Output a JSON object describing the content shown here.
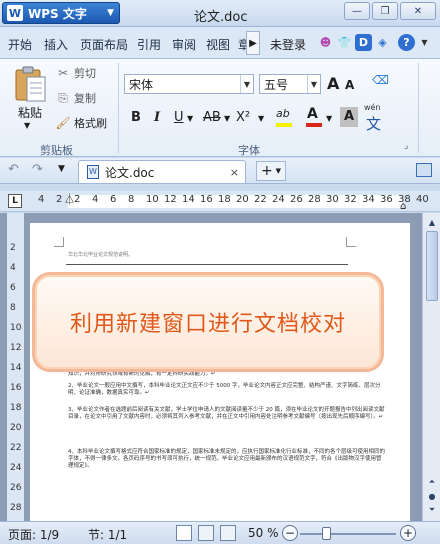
{
  "app": {
    "name": "WPS 文字",
    "logo_letter": "W",
    "dropdown_icon": "triangle-down-icon"
  },
  "window": {
    "title": "论文.doc",
    "buttons": [
      "minimize",
      "restore",
      "close"
    ]
  },
  "menu": {
    "tabs": [
      "开始",
      "插入",
      "页面布局",
      "引用",
      "审阅",
      "视图",
      "章"
    ],
    "login": "未登录"
  },
  "ribbon": {
    "clipboard": {
      "paste_label": "粘贴",
      "cut_label": "剪切",
      "copy_label": "复制",
      "format_painter_label": "格式刷",
      "group_label": "剪贴板"
    },
    "font": {
      "font_name": "宋体",
      "font_size": "五号",
      "group_label": "字体",
      "wen_label": "wén",
      "wen_char": "文",
      "grow_glyph": "A",
      "shrink_glyph": "A",
      "bold": "B",
      "italic": "I",
      "underline": "U",
      "strikethrough": "AB",
      "superscript": "X²",
      "highlight_label": "ab",
      "font_color_label": "A",
      "char_shade_label": "A"
    }
  },
  "doc_tabs": {
    "active": "论文.doc",
    "close_glyph": "×",
    "add_glyph": "+"
  },
  "ruler": {
    "marks": [
      "4",
      "2",
      "2",
      "4",
      "6",
      "8",
      "10",
      "12",
      "14",
      "16",
      "18",
      "20",
      "22",
      "24",
      "26",
      "28",
      "30",
      "32",
      "34",
      "36",
      "38",
      "40",
      "44"
    ]
  },
  "vruler": {
    "marks": [
      "2",
      "4",
      "6",
      "8",
      "10",
      "12",
      "14",
      "16",
      "18",
      "20",
      "22",
      "24",
      "26",
      "28"
    ]
  },
  "document": {
    "header": "华北华北毕业论文规范说明。",
    "overlay_text": "利用新建窗口进行文档校对",
    "paragraphs": [
      "知识，并对所研究领域有新的见解，有一定科研实践能力。↵",
      "2、毕业论文一般应用中文撰写，本科毕业论文正文应不少于 5000 字，毕业论文内容正文应完整、结构严谨、文字简练、层次分明、论证准确，数据真实可靠。↵",
      "3、毕业论文作者在选题前后阅读有关文献，学士学位申请人的文献阅读量不少于 20 篇，须在毕业论文的开题报告中列出阅读文献目录，在论文中引用了文献内容时，必须将其列入参考文献，并在正文中引用内容处注明参考文献编号（按出现先后顺序编写）。↵",
      "4、本科毕业论文撰写格式应符合国家标准的规定，国家标准未规定的，应执行国家标准化行业标准，不同的各个层级可使用相同的字体，不得一律多文，各页码序号的书写须可执行，统一规范。毕业论文应用最新颁布的汉语规范文字，符合《出版物汉字使用管理规定》。"
    ]
  },
  "status": {
    "page": "页面: 1/9",
    "section": "节: 1/1",
    "zoom": "50 %",
    "zoom_level": 0.5
  }
}
